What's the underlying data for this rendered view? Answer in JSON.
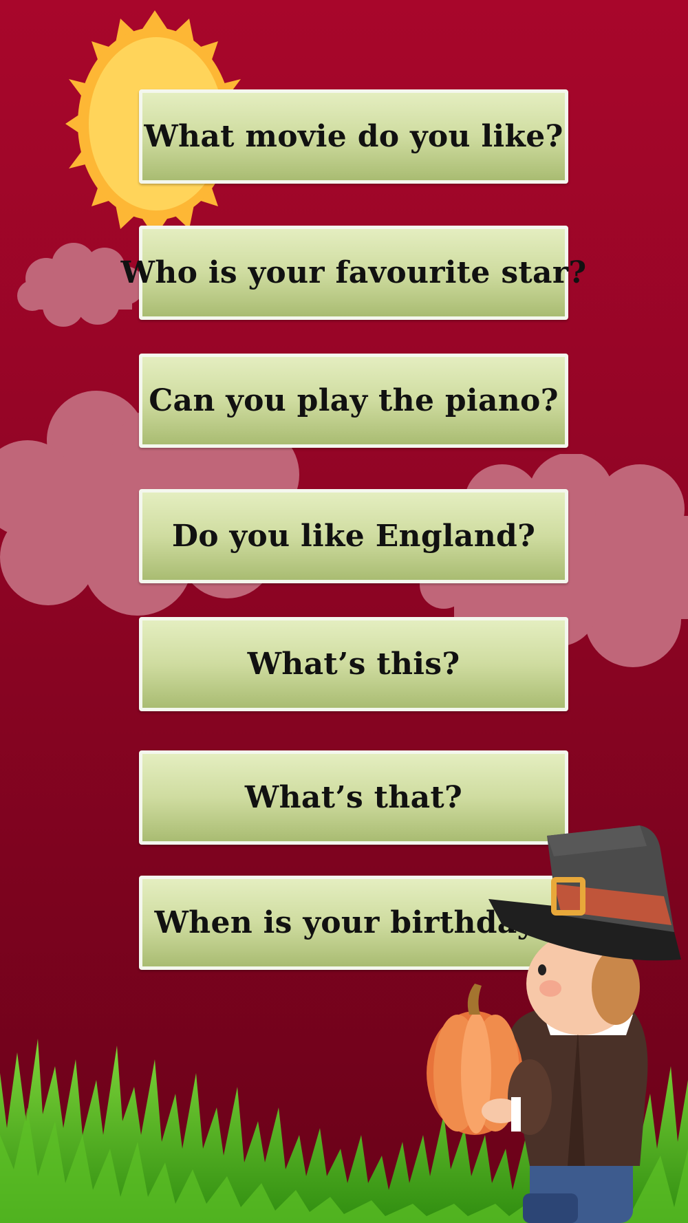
{
  "questions": [
    {
      "label": "What movie do you like?"
    },
    {
      "label": "Who is your favourite star?"
    },
    {
      "label": "Can you play the piano?"
    },
    {
      "label": "Do you like England?"
    },
    {
      "label": "What’s this?"
    },
    {
      "label": "What’s that?"
    },
    {
      "label": "When is your birthday?"
    }
  ],
  "colors": {
    "background_top": "#a8062b",
    "background_bottom": "#6a0219",
    "button_top": "#e4eec0",
    "button_bottom": "#a9bc72",
    "button_border": "#f4f7ee",
    "sun": "#ffd45a",
    "cloud": "#c06679",
    "grass": "#4fb31c"
  },
  "decorations": [
    "sun-icon",
    "cloud-icon",
    "grass-illustration",
    "pilgrim-boy-illustration",
    "pumpkin-icon"
  ]
}
